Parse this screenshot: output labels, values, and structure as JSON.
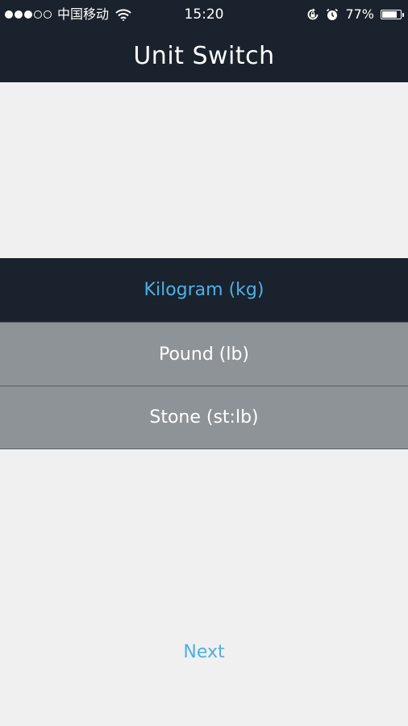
{
  "status_bar": {
    "signal_dots": [
      true,
      true,
      true,
      false,
      false
    ],
    "carrier": "中国移动",
    "time": "15:20",
    "battery_percent": "77%",
    "battery_level": 0.77,
    "icons": [
      "wifi-icon",
      "rotation-lock-icon",
      "alarm-icon",
      "battery-icon"
    ]
  },
  "nav": {
    "title": "Unit Switch"
  },
  "units": {
    "selected_index": 0,
    "options": [
      {
        "label": "Kilogram (kg)"
      },
      {
        "label": "Pound (lb)"
      },
      {
        "label": "Stone (st:lb)"
      }
    ]
  },
  "footer": {
    "next_label": "Next"
  },
  "colors": {
    "dark": "#1a222d",
    "accent": "#4db0e4",
    "option_bg": "#8e9397",
    "page_bg": "#f0f0f0"
  }
}
